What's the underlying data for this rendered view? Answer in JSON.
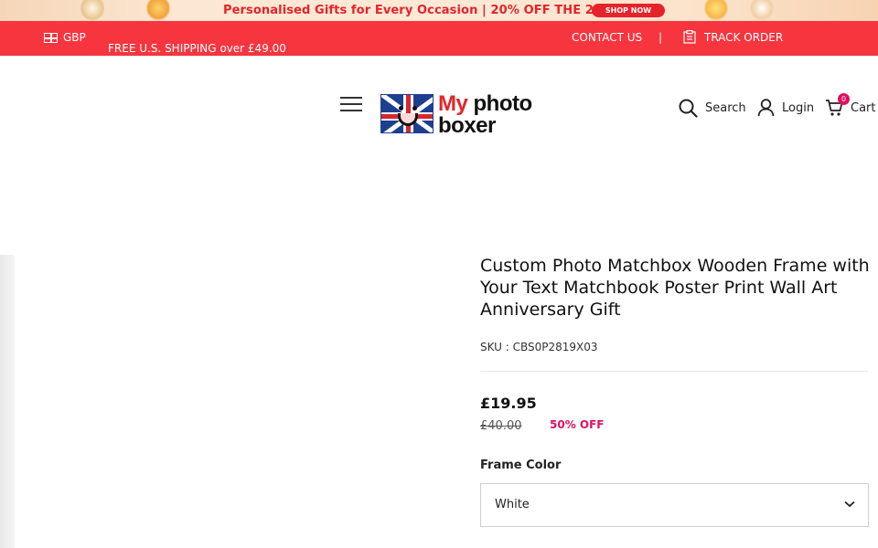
{
  "promo": {
    "text": "Personalised Gifts for Every Occasion |  20% OFF THE 2ND",
    "button": "SHOP NOW",
    "accent": "#e5232a"
  },
  "topbar": {
    "currency": "GBP",
    "shipping": "FREE U.S. SHIPPING over £49.00",
    "contact": "CONTACT US",
    "separator": "|",
    "track": "TRACK ORDER",
    "background": "#f6353f"
  },
  "header": {
    "logo_my": "My",
    "logo_photo": " photo",
    "logo_boxer": "boxer",
    "search_label": "Search",
    "login_label": "Login",
    "cart_label": "Cart",
    "cart_count": "0"
  },
  "product": {
    "title": "Custom Photo Matchbox Wooden Frame with Your Text Matchbook Poster Print Wall Art Anniversary Gift",
    "sku": "SKU : CBS0P2819X03",
    "price": "£19.95",
    "old_price": "£40.00",
    "discount": "50% OFF",
    "discount_color": "#e0115f",
    "option_label": "Frame Color",
    "option_value": "White"
  },
  "icons": [
    "flag-icon",
    "clipboard-icon",
    "menu-icon",
    "search-icon",
    "user-icon",
    "cart-icon",
    "chevron-down-icon"
  ]
}
